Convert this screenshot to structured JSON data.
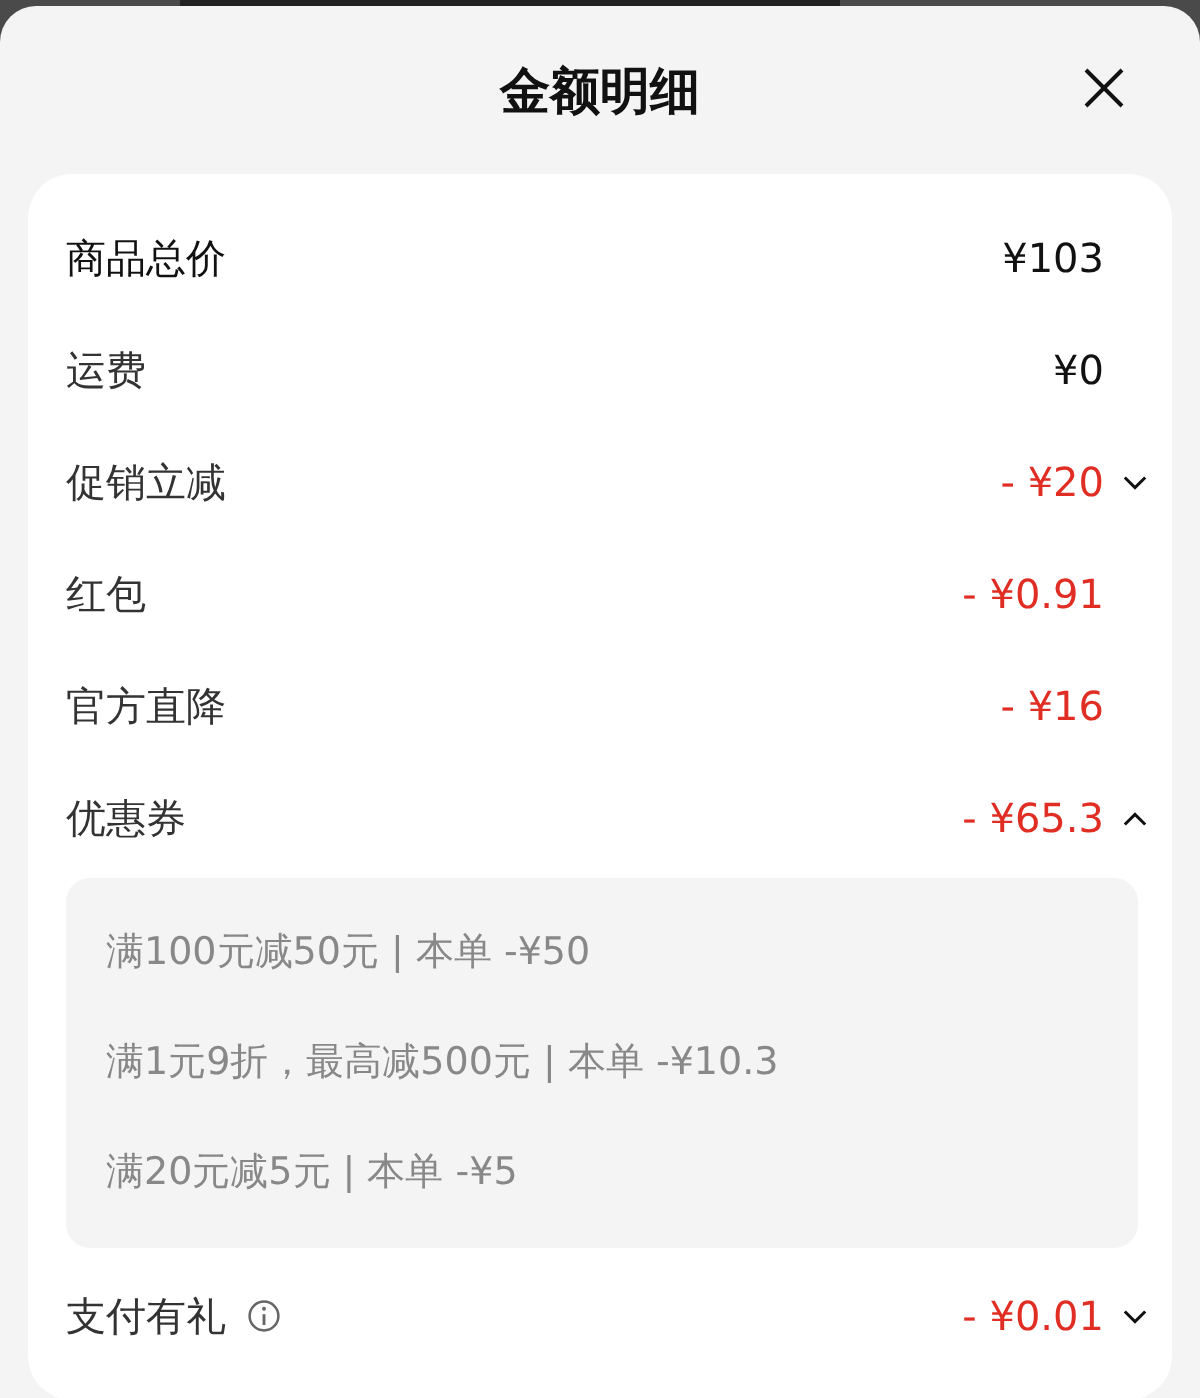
{
  "title": "金额明细",
  "rows": [
    {
      "label": "商品总价",
      "amount": "¥103",
      "kind": "total"
    },
    {
      "label": "运费",
      "amount": "¥0",
      "kind": "plain"
    },
    {
      "label": "促销立减",
      "amount": "- ¥20",
      "kind": "discount",
      "expanded": false
    },
    {
      "label": "红包",
      "amount": "- ¥0.91",
      "kind": "discount"
    },
    {
      "label": "官方直降",
      "amount": "- ¥16",
      "kind": "discount"
    },
    {
      "label": "优惠券",
      "amount": "- ¥65.3",
      "kind": "discount",
      "expanded": true,
      "details": [
        "满100元减50元 | 本单 -¥50",
        "满1元9折，最高减500元 | 本单 -¥10.3",
        "满20元减5元 | 本单 -¥5"
      ]
    },
    {
      "label": "支付有礼",
      "amount": "- ¥0.01",
      "kind": "discount",
      "expanded": false,
      "info": true
    }
  ]
}
